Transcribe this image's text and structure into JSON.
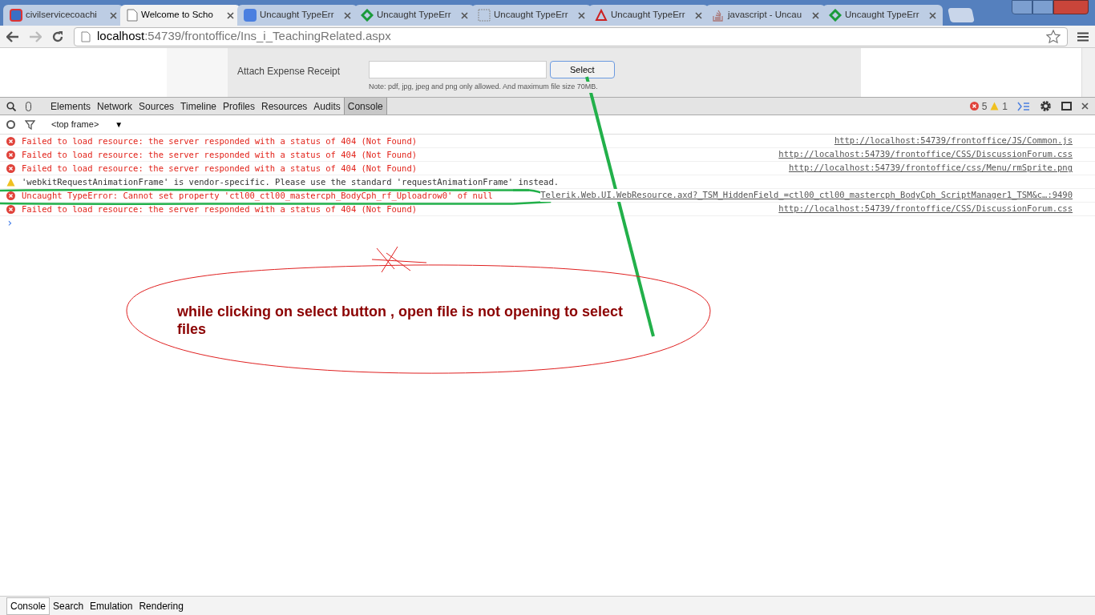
{
  "browser_tabs": [
    {
      "kind": "calendar",
      "title": "civilservicecoachi",
      "selected": false
    },
    {
      "kind": "page",
      "title": "Welcome to Scho",
      "selected": true
    },
    {
      "kind": "google",
      "title": "Uncaught TypeErr",
      "selected": false
    },
    {
      "kind": "diamond",
      "title": "Uncaught TypeErr",
      "selected": false
    },
    {
      "kind": "grid",
      "title": "Uncaught TypeErr",
      "selected": false
    },
    {
      "kind": "triangle",
      "title": "Uncaught TypeErr",
      "selected": false
    },
    {
      "kind": "stack",
      "title": "javascript - Uncau",
      "selected": false
    },
    {
      "kind": "diamond",
      "title": "Uncaught TypeErr",
      "selected": false
    }
  ],
  "address_bar": {
    "host": "localhost",
    "path": ":54739/frontoffice/Ins_i_TeachingRelated.aspx"
  },
  "page": {
    "label": "Attach Expense Receipt",
    "button": "Select",
    "note": "Note: pdf, jpg, jpeg and png only allowed. And maximum file size 70MB."
  },
  "devtools": {
    "tabs": [
      {
        "label": "Elements",
        "selected": false
      },
      {
        "label": "Network",
        "selected": false
      },
      {
        "label": "Sources",
        "selected": false
      },
      {
        "label": "Timeline",
        "selected": false
      },
      {
        "label": "Profiles",
        "selected": false
      },
      {
        "label": "Resources",
        "selected": false
      },
      {
        "label": "Audits",
        "selected": false
      },
      {
        "label": "Console",
        "selected": true
      }
    ],
    "error_count": "5",
    "warning_count": "1",
    "frame": "<top frame>",
    "frame_caret": "▼",
    "messages": [
      {
        "kind": "error",
        "text": "Failed to load resource: the server responded with a status of 404 (Not Found)",
        "source": "http://localhost:54739/frontoffice/JS/Common.js"
      },
      {
        "kind": "error",
        "text": "Failed to load resource: the server responded with a status of 404 (Not Found)",
        "source": "http://localhost:54739/frontoffice/CSS/DiscussionForum.css"
      },
      {
        "kind": "error",
        "text": "Failed to load resource: the server responded with a status of 404 (Not Found)",
        "source": "http://localhost:54739/frontoffice/css/Menu/rmSprite.png"
      },
      {
        "kind": "warning",
        "text": "'webkitRequestAnimationFrame' is vendor-specific. Please use the standard 'requestAnimationFrame' instead."
      },
      {
        "kind": "error",
        "text": "Uncaught TypeError: Cannot set property 'ctl00_ctl00_mastercph_BodyCph_rf_Uploadrow0' of null",
        "source": "Telerik.Web.UI.WebResource.axd?_TSM_HiddenField_=ctl00_ctl00_mastercph_BodyCph_ScriptManager1_TSM&c…:9490"
      },
      {
        "kind": "error",
        "text": "Failed to load resource: the server responded with a status of 404 (Not Found)",
        "source": "http://localhost:54739/frontoffice/CSS/DiscussionForum.css"
      }
    ],
    "prompt": "›",
    "drawer_tabs": [
      {
        "label": "Console",
        "selected": true
      },
      {
        "label": "Search",
        "selected": false
      },
      {
        "label": "Emulation",
        "selected": false
      },
      {
        "label": "Rendering",
        "selected": false
      }
    ]
  },
  "annotation": {
    "text": "while clicking on select button , open file is not opening to select files"
  }
}
